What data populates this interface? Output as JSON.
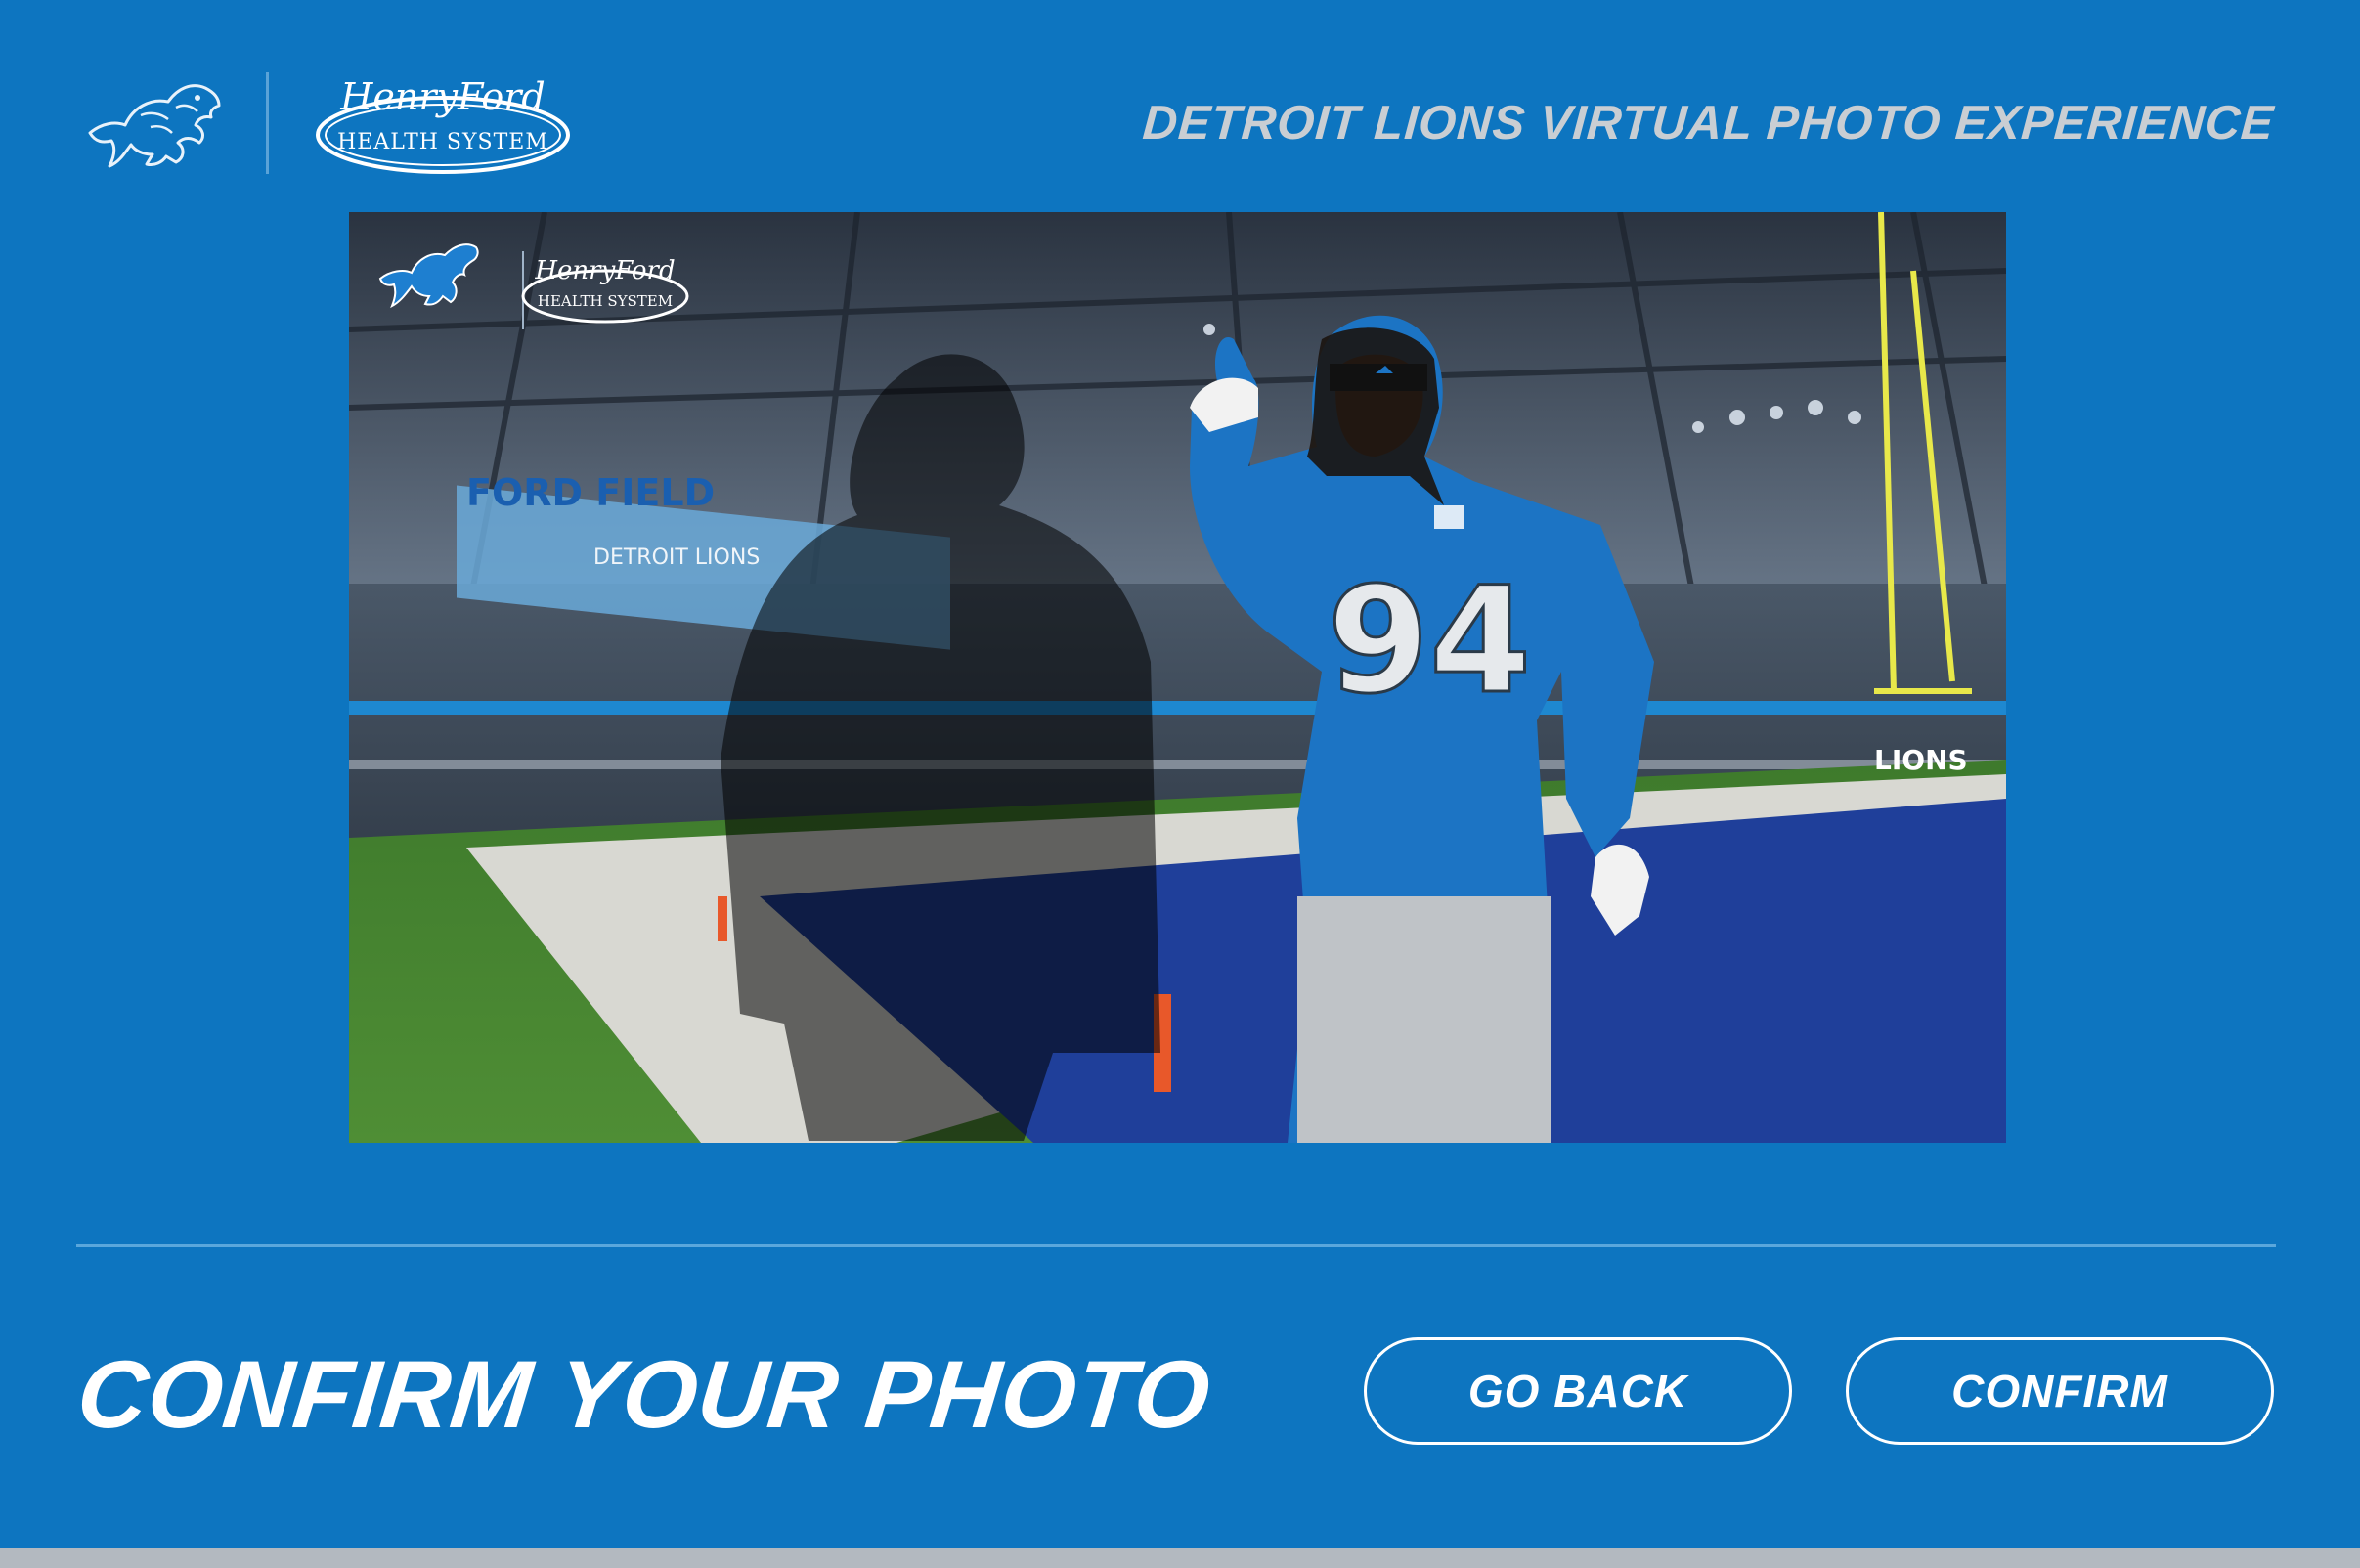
{
  "header": {
    "title": "DETROIT LIONS VIRTUAL PHOTO EXPERIENCE",
    "team_logo": "lion-icon",
    "sponsor_logo_line1": "HenryFord",
    "sponsor_logo_line2": "HEALTH SYSTEM"
  },
  "photo": {
    "jersey_number": "94",
    "banner_text": "FORD FIELD",
    "board_text": "DETROIT LIONS",
    "endzone_text": "LIONS",
    "overlay_sponsor_line1": "HenryFord",
    "overlay_sponsor_line2": "HEALTH SYSTEM"
  },
  "footer": {
    "title": "CONFIRM YOUR PHOTO",
    "back_label": "GO BACK",
    "confirm_label": "CONFIRM"
  },
  "colors": {
    "background": "#0d75c0",
    "title_gray": "#c9ced3",
    "button_border": "#ffffff",
    "bottom_bar": "#b3b9c0"
  }
}
